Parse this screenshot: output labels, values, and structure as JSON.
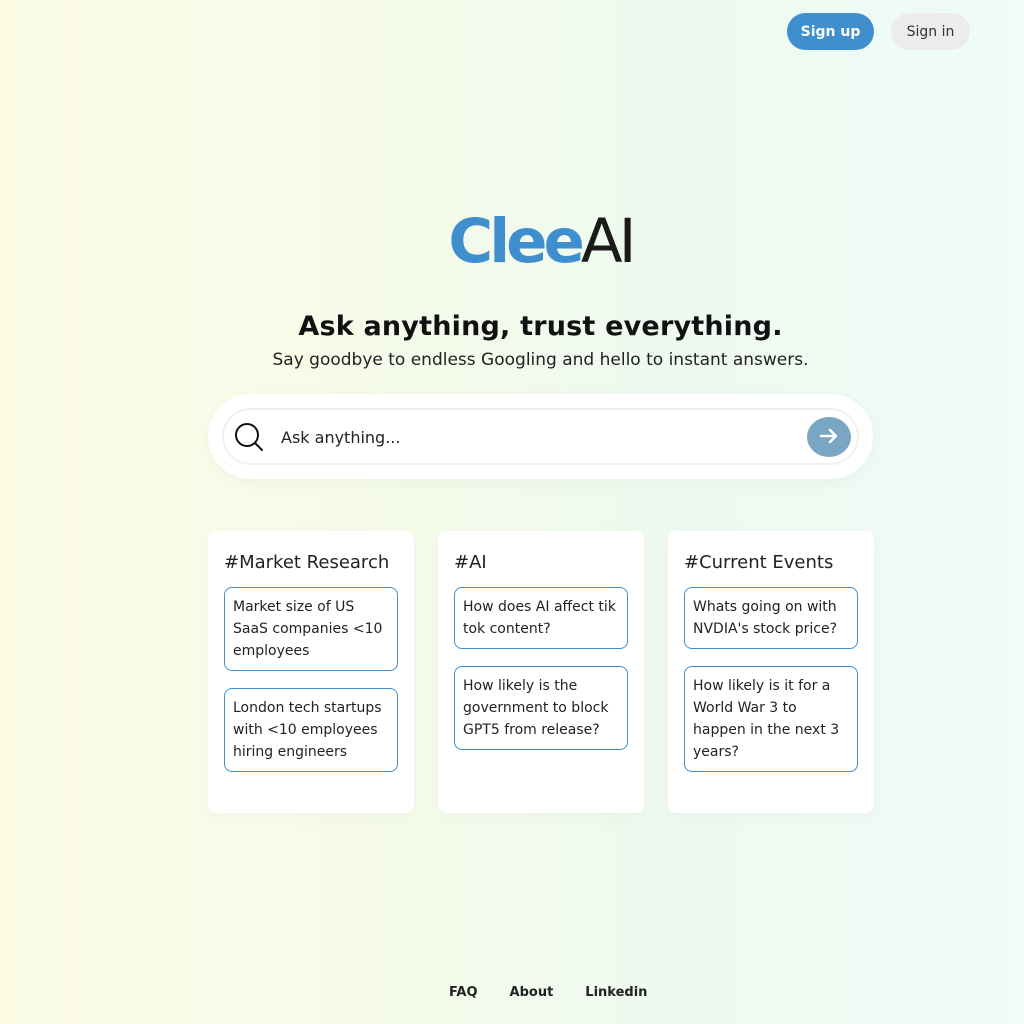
{
  "nav": {
    "signup_label": "Sign up",
    "signin_label": "Sign in"
  },
  "logo": {
    "part1": "Clee",
    "part2": "AI"
  },
  "hero": {
    "headline": "Ask anything, trust everything.",
    "subline": "Say goodbye to endless Googling and hello to instant answers."
  },
  "search": {
    "placeholder": "Ask anything...",
    "icon": "search-icon",
    "submit_icon": "arrow-right-icon"
  },
  "cards": [
    {
      "title": "#Market Research",
      "questions": [
        "Market size of US SaaS companies <10 employees",
        "London tech startups with <10 employees hiring engineers"
      ]
    },
    {
      "title": "#AI",
      "questions": [
        "How does AI affect tik tok content?",
        "How likely is the government to block GPT5 from release?"
      ]
    },
    {
      "title": "#Current Events",
      "questions": [
        "Whats going on with NVDIA's stock price?",
        "How likely is it for a World War 3 to happen in the next 3 years?"
      ]
    }
  ],
  "footer": {
    "faq": "FAQ",
    "about": "About",
    "linkedin": "Linkedin"
  },
  "colors": {
    "accent": "#3f8fcf",
    "submit": "#7aa6c4"
  }
}
